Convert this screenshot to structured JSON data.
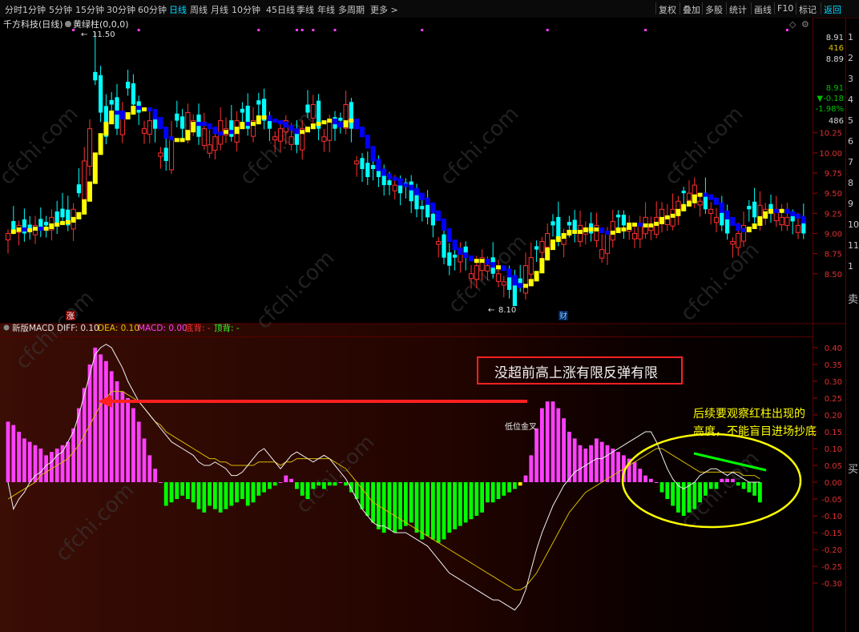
{
  "toolbar": {
    "tabs": [
      "分时",
      "1分钟",
      "5分钟",
      "15分钟",
      "30分钟",
      "60分钟",
      "日线",
      "周线",
      "月线",
      "10分钟",
      "45日线",
      "季线",
      "年线",
      "多周期",
      "更多 >"
    ],
    "active_tab": "日线",
    "right_buttons": [
      "复权",
      "叠加",
      "多股",
      "统计",
      "画线",
      "F10",
      "标记",
      "返回"
    ],
    "active_right": "返回"
  },
  "main_panel": {
    "title": "千方科技(日线)",
    "indicator_label": "黄绿柱(0,0,0)",
    "high_label": "11.50",
    "low_label": "8.10",
    "markers": {
      "zhang": "涨",
      "cai": "财"
    },
    "right_info": [
      "8.91",
      "416",
      "8.89",
      "8.91",
      "▼-0.18",
      "-1.98%",
      "486"
    ],
    "right_info_colors": [
      "#d8d8d8",
      "#e0c000",
      "#d8d8d8",
      "#00c000",
      "#00c000",
      "#00c000",
      "#d8d8d8"
    ],
    "right_info_badges": [
      "1",
      "2",
      "3",
      "4",
      "5",
      "6",
      "7",
      "8",
      "9",
      "10",
      "11",
      "1"
    ],
    "sell_label": "卖",
    "price_ticks": [
      10.25,
      10.0,
      9.75,
      9.5,
      9.25,
      9.0,
      8.75,
      8.5
    ]
  },
  "macd_panel": {
    "title": "新版MACD",
    "diff_label": "DIFF: 0.10",
    "dea_label": "DEA: 0.10",
    "macd_label": "MACD: 0.00",
    "bottom_div": "底背: -",
    "top_div": "顶背: -",
    "ticks": [
      0.4,
      0.35,
      0.3,
      0.25,
      0.2,
      0.15,
      0.1,
      0.05,
      0.0,
      -0.05,
      -0.1,
      -0.15,
      -0.2,
      -0.25,
      -0.3
    ],
    "buy_label": "买",
    "cross_label": "低位金叉"
  },
  "annotations": {
    "red_box_text": "没超前高上涨有限反弹有限",
    "yellow_note_line1": "后续要观察红柱出现的",
    "yellow_note_line2": "高度，不能盲目进场抄底"
  },
  "colors": {
    "up": "#ff3030",
    "down": "#00ffff",
    "ma_up": "#ffff00",
    "ma_down": "#0000ff",
    "macd_pos": "#ff40ff",
    "macd_neg": "#00ff00",
    "annotation_red": "#ff2020",
    "annotation_yellow": "#ffff00"
  },
  "chart_data": {
    "type": "candlestick+macd",
    "price": {
      "ylim": [
        8.1,
        11.5
      ],
      "high": 11.5,
      "low": 8.1,
      "close": [
        9.0,
        9.05,
        9.1,
        9.0,
        9.05,
        9.1,
        9.05,
        9.1,
        9.2,
        9.1,
        9.2,
        9.1,
        9.3,
        9.5,
        9.9,
        10.3,
        10.9,
        10.5,
        10.2,
        10.6,
        10.3,
        10.5,
        10.8,
        10.6,
        10.5,
        10.3,
        10.4,
        10.3,
        10.0,
        9.9,
        10.2,
        10.4,
        10.3,
        10.5,
        10.4,
        10.2,
        10.3,
        10.1,
        10.2,
        10.4,
        10.3,
        10.2,
        10.4,
        10.5,
        10.3,
        10.4,
        10.6,
        10.4,
        10.3,
        10.2,
        10.3,
        10.4,
        10.2,
        10.1,
        10.3,
        10.5,
        10.6,
        10.3,
        10.2,
        10.4,
        10.3,
        10.4,
        10.6,
        10.3,
        9.9,
        9.8,
        9.7,
        9.8,
        9.7,
        9.6,
        9.6,
        9.6,
        9.5,
        9.6,
        9.4,
        9.3,
        9.3,
        9.2,
        9.1,
        8.9,
        8.7,
        8.6,
        8.7,
        8.8,
        8.7,
        8.5,
        8.6,
        8.7,
        8.6,
        8.5,
        8.5,
        8.4,
        8.3,
        8.1,
        8.35,
        8.6,
        8.7,
        8.8,
        8.9,
        9.0,
        9.1,
        8.9,
        9.0,
        9.1,
        9.0,
        9.1,
        9.05,
        9.0,
        9.1,
        8.8,
        9.0,
        9.15,
        9.2,
        9.1,
        9.1,
        9.0,
        9.1,
        9.2,
        9.1,
        9.2,
        9.3,
        9.2,
        9.3,
        9.4,
        9.5,
        9.5,
        9.6,
        9.4,
        9.3,
        9.3,
        9.2,
        9.1,
        9.0,
        8.9,
        9.0,
        9.1,
        9.3,
        9.2,
        9.35,
        9.3,
        9.25,
        9.3,
        9.2,
        9.2,
        9.15,
        9.1,
        9.0
      ]
    },
    "macd": {
      "ylim": [
        -0.3,
        0.4
      ],
      "hist": [
        0.18,
        0.17,
        0.15,
        0.13,
        0.12,
        0.11,
        0.1,
        0.08,
        0.09,
        0.1,
        0.11,
        0.12,
        0.16,
        0.22,
        0.28,
        0.35,
        0.4,
        0.38,
        0.36,
        0.33,
        0.3,
        0.27,
        0.25,
        0.22,
        0.18,
        0.13,
        0.08,
        0.04,
        0.0,
        -0.07,
        -0.06,
        -0.05,
        -0.04,
        -0.05,
        -0.06,
        -0.08,
        -0.09,
        -0.07,
        -0.08,
        -0.09,
        -0.08,
        -0.07,
        -0.06,
        -0.05,
        -0.07,
        -0.06,
        -0.04,
        -0.03,
        -0.02,
        -0.01,
        0.0,
        0.02,
        0.01,
        -0.02,
        -0.04,
        -0.05,
        -0.02,
        -0.01,
        -0.02,
        -0.01,
        -0.01,
        0.0,
        -0.01,
        -0.03,
        -0.05,
        -0.08,
        -0.1,
        -0.12,
        -0.14,
        -0.15,
        -0.14,
        -0.15,
        -0.14,
        -0.13,
        -0.12,
        -0.15,
        -0.17,
        -0.16,
        -0.17,
        -0.18,
        -0.17,
        -0.15,
        -0.14,
        -0.13,
        -0.12,
        -0.11,
        -0.1,
        -0.09,
        -0.06,
        -0.06,
        -0.05,
        -0.04,
        -0.03,
        -0.02,
        -0.01,
        0.02,
        0.08,
        0.16,
        0.22,
        0.24,
        0.24,
        0.22,
        0.19,
        0.15,
        0.13,
        0.11,
        0.1,
        0.11,
        0.13,
        0.12,
        0.11,
        0.1,
        0.09,
        0.08,
        0.07,
        0.06,
        0.04,
        0.02,
        0.01,
        0.0,
        -0.03,
        -0.05,
        -0.07,
        -0.09,
        -0.1,
        -0.09,
        -0.08,
        -0.06,
        -0.04,
        -0.02,
        -0.02,
        0.01,
        0.01,
        0.01,
        -0.01,
        -0.02,
        -0.03,
        -0.04,
        -0.06
      ],
      "hist_yellow_index": 94,
      "diff": [
        0.0,
        -0.08,
        -0.05,
        -0.03,
        0.0,
        0.02,
        0.03,
        0.05,
        0.06,
        0.08,
        0.09,
        0.12,
        0.15,
        0.2,
        0.26,
        0.32,
        0.38,
        0.4,
        0.41,
        0.4,
        0.37,
        0.34,
        0.3,
        0.27,
        0.24,
        0.22,
        0.2,
        0.18,
        0.16,
        0.14,
        0.12,
        0.11,
        0.1,
        0.09,
        0.08,
        0.06,
        0.05,
        0.05,
        0.06,
        0.05,
        0.04,
        0.02,
        0.02,
        0.03,
        0.05,
        0.07,
        0.09,
        0.1,
        0.08,
        0.06,
        0.04,
        0.06,
        0.08,
        0.09,
        0.08,
        0.07,
        0.06,
        0.07,
        0.08,
        0.07,
        0.05,
        0.03,
        0.01,
        -0.02,
        -0.05,
        -0.08,
        -0.1,
        -0.12,
        -0.13,
        -0.13,
        -0.14,
        -0.15,
        -0.15,
        -0.15,
        -0.16,
        -0.17,
        -0.18,
        -0.19,
        -0.21,
        -0.23,
        -0.25,
        -0.27,
        -0.28,
        -0.29,
        -0.3,
        -0.31,
        -0.32,
        -0.33,
        -0.34,
        -0.35,
        -0.35,
        -0.36,
        -0.37,
        -0.38,
        -0.36,
        -0.32,
        -0.26,
        -0.2,
        -0.15,
        -0.11,
        -0.07,
        -0.04,
        -0.01,
        0.01,
        0.03,
        0.04,
        0.05,
        0.06,
        0.07,
        0.07,
        0.08,
        0.09,
        0.1,
        0.11,
        0.12,
        0.13,
        0.14,
        0.15,
        0.15,
        0.12,
        0.08,
        0.04,
        0.01,
        -0.01,
        -0.02,
        -0.01,
        0.0,
        0.02,
        0.03,
        0.04,
        0.04,
        0.03,
        0.02,
        0.03,
        0.02,
        0.01,
        0.0,
        0.0,
        0.0
      ],
      "dea": [
        -0.05,
        -0.04,
        -0.03,
        -0.02,
        -0.01,
        0.0,
        0.02,
        0.03,
        0.04,
        0.05,
        0.06,
        0.07,
        0.09,
        0.11,
        0.14,
        0.17,
        0.2,
        0.23,
        0.25,
        0.27,
        0.27,
        0.27,
        0.26,
        0.25,
        0.24,
        0.22,
        0.2,
        0.18,
        0.17,
        0.15,
        0.14,
        0.13,
        0.12,
        0.11,
        0.1,
        0.09,
        0.08,
        0.07,
        0.07,
        0.06,
        0.06,
        0.05,
        0.05,
        0.05,
        0.05,
        0.05,
        0.06,
        0.06,
        0.06,
        0.06,
        0.05,
        0.06,
        0.06,
        0.07,
        0.07,
        0.07,
        0.07,
        0.07,
        0.07,
        0.07,
        0.06,
        0.05,
        0.04,
        0.02,
        0.0,
        -0.02,
        -0.04,
        -0.06,
        -0.07,
        -0.08,
        -0.09,
        -0.1,
        -0.11,
        -0.12,
        -0.13,
        -0.14,
        -0.15,
        -0.16,
        -0.17,
        -0.18,
        -0.19,
        -0.2,
        -0.21,
        -0.22,
        -0.23,
        -0.24,
        -0.25,
        -0.26,
        -0.27,
        -0.28,
        -0.29,
        -0.3,
        -0.31,
        -0.32,
        -0.32,
        -0.31,
        -0.29,
        -0.27,
        -0.24,
        -0.21,
        -0.18,
        -0.15,
        -0.12,
        -0.09,
        -0.07,
        -0.05,
        -0.03,
        -0.02,
        -0.01,
        0.0,
        0.01,
        0.02,
        0.03,
        0.04,
        0.05,
        0.06,
        0.07,
        0.08,
        0.09,
        0.1,
        0.1,
        0.09,
        0.08,
        0.07,
        0.06,
        0.05,
        0.04,
        0.03,
        0.03,
        0.03,
        0.03,
        0.03,
        0.03,
        0.03,
        0.03,
        0.02,
        0.02,
        0.02,
        0.01
      ]
    }
  }
}
